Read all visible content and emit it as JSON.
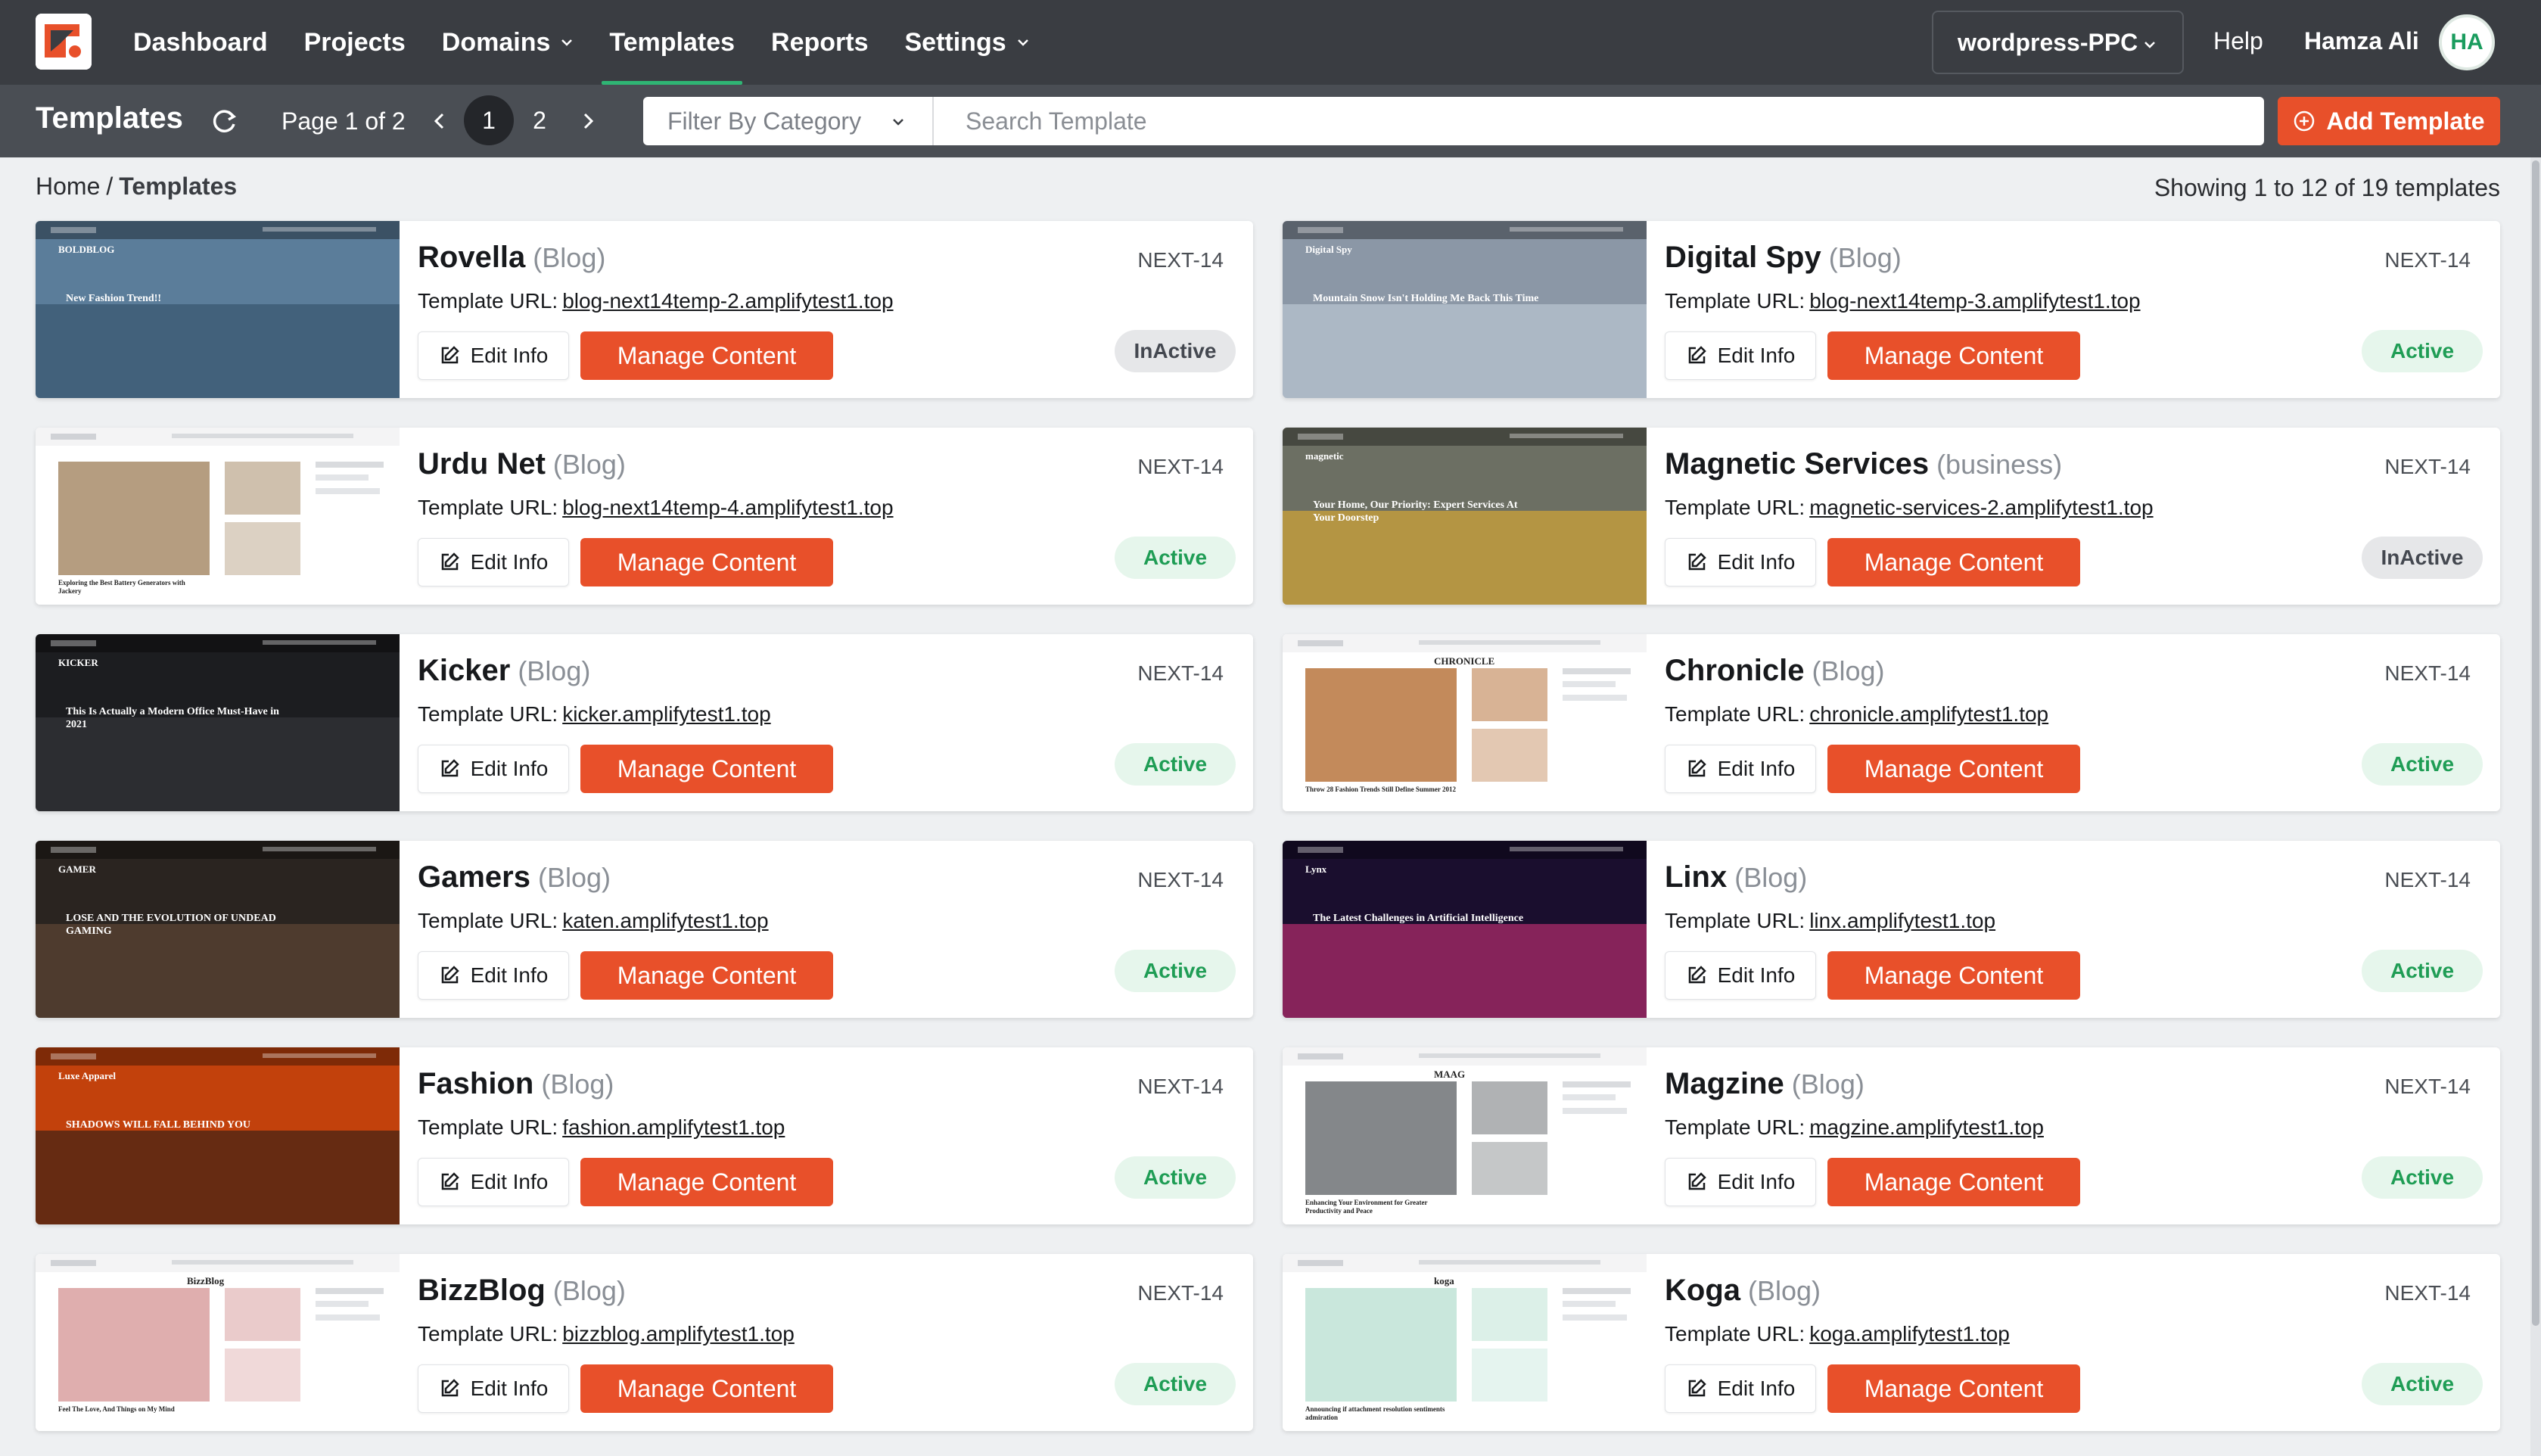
{
  "nav": {
    "items": [
      {
        "label": "Dashboard",
        "dropdown": false,
        "active": false
      },
      {
        "label": "Projects",
        "dropdown": false,
        "active": false
      },
      {
        "label": "Domains",
        "dropdown": true,
        "active": false
      },
      {
        "label": "Templates",
        "dropdown": false,
        "active": true
      },
      {
        "label": "Reports",
        "dropdown": false,
        "active": false
      },
      {
        "label": "Settings",
        "dropdown": true,
        "active": false
      }
    ],
    "site_selector": "wordpress-PPC",
    "help": "Help",
    "user_name": "Hamza Ali",
    "user_initials": "HA"
  },
  "toolbar": {
    "title": "Templates",
    "page_info": "Page 1 of 2",
    "pages": [
      "1",
      "2"
    ],
    "current_page": "1",
    "filter_placeholder": "Filter By Category",
    "search_placeholder": "Search Template",
    "add_label": "Add Template"
  },
  "breadcrumb": {
    "home": "Home",
    "sep": "/",
    "current": "Templates"
  },
  "showing": "Showing 1 to 12 of 19 templates",
  "card_labels": {
    "url_label": "Template URL:",
    "edit": "Edit Info",
    "manage": "Manage Content"
  },
  "colors": {
    "accent": "#e8502a",
    "nav_bg": "#3a3d42",
    "toolbar_bg": "#4a4e54",
    "active_green": "#1f9d55"
  },
  "templates": [
    {
      "name": "Rovella",
      "category": "(Blog)",
      "version": "NEXT-14",
      "url": "blog-next14temp-2.amplifytest1.top",
      "status": "InActive",
      "thumb": {
        "bg": "#5b7d9a",
        "accent": "#2d4a63",
        "light": true,
        "headline": "New Fashion Trend!!",
        "brand": "BOLDBLOG"
      }
    },
    {
      "name": "Digital Spy",
      "category": "(Blog)",
      "version": "NEXT-14",
      "url": "blog-next14temp-3.amplifytest1.top",
      "status": "Active",
      "thumb": {
        "bg": "#8b97a6",
        "accent": "#c9d3de",
        "light": true,
        "headline": "Mountain Snow Isn't Holding Me Back This Time",
        "brand": "Digital Spy"
      }
    },
    {
      "name": "Urdu Net",
      "category": "(Blog)",
      "version": "NEXT-14",
      "url": "blog-next14temp-4.amplifytest1.top",
      "status": "Active",
      "thumb": {
        "bg": "#ffffff",
        "accent": "#a88c6a",
        "light": false,
        "headline": "Exploring the Best Battery Generators with Jackery",
        "brand": ""
      }
    },
    {
      "name": "Magnetic Services",
      "category": "(business)",
      "version": "NEXT-14",
      "url": "magnetic-services-2.amplifytest1.top",
      "status": "InActive",
      "thumb": {
        "bg": "#6c6f63",
        "accent": "#f0b429",
        "light": true,
        "headline": "Your Home, Our Priority: Expert Services At Your Doorstep",
        "brand": "magnetic"
      }
    },
    {
      "name": "Kicker",
      "category": "(Blog)",
      "version": "NEXT-14",
      "url": "kicker.amplifytest1.top",
      "status": "Active",
      "thumb": {
        "bg": "#1c1d20",
        "accent": "#3a3b40",
        "light": true,
        "headline": "This Is Actually a Modern Office Must-Have in 2021",
        "brand": "KICKER"
      }
    },
    {
      "name": "Chronicle",
      "category": "(Blog)",
      "version": "NEXT-14",
      "url": "chronicle.amplifytest1.top",
      "status": "Active",
      "thumb": {
        "bg": "#ffffff",
        "accent": "#b8753e",
        "light": false,
        "headline": "Throw 28 Fashion Trends Still Define Summer 2012",
        "brand": "CHRONICLE"
      }
    },
    {
      "name": "Gamers",
      "category": "(Blog)",
      "version": "NEXT-14",
      "url": "katen.amplifytest1.top",
      "status": "Active",
      "thumb": {
        "bg": "#2a2420",
        "accent": "#6b4f3a",
        "light": true,
        "headline": "LOSE AND THE EVOLUTION OF UNDEAD GAMING",
        "brand": "GAMER"
      }
    },
    {
      "name": "Linx",
      "category": "(Blog)",
      "version": "NEXT-14",
      "url": "linx.amplifytest1.top",
      "status": "Active",
      "thumb": {
        "bg": "#1a0e2e",
        "accent": "#e0357f",
        "light": true,
        "headline": "The Latest Challenges in Artificial Intelligence",
        "brand": "Lynx"
      }
    },
    {
      "name": "Fashion",
      "category": "(Blog)",
      "version": "NEXT-14",
      "url": "fashion.amplifytest1.top",
      "status": "Active",
      "thumb": {
        "bg": "#c2410c",
        "accent": "#1c1917",
        "light": true,
        "headline": "SHADOWS WILL FALL BEHIND YOU",
        "brand": "Luxe Apparel"
      }
    },
    {
      "name": "Magzine",
      "category": "(Blog)",
      "version": "NEXT-14",
      "url": "magzine.amplifytest1.top",
      "status": "Active",
      "thumb": {
        "bg": "#ffffff",
        "accent": "#6f7276",
        "light": false,
        "headline": "Enhancing Your Environment for Greater Productivity and Peace",
        "brand": "MAAG"
      }
    },
    {
      "name": "BizzBlog",
      "category": "(Blog)",
      "version": "NEXT-14",
      "url": "bizzblog.amplifytest1.top",
      "status": "Active",
      "thumb": {
        "bg": "#ffffff",
        "accent": "#d9a0a0",
        "light": false,
        "headline": "Feel The Love, And Things on My Mind",
        "brand": "BizzBlog"
      }
    },
    {
      "name": "Koga",
      "category": "(Blog)",
      "version": "NEXT-14",
      "url": "koga.amplifytest1.top",
      "status": "Active",
      "thumb": {
        "bg": "#ffffff",
        "accent": "#bfe3d6",
        "light": false,
        "headline": "Announcing if attachment resolution sentiments admiration",
        "brand": "koga"
      }
    }
  ]
}
